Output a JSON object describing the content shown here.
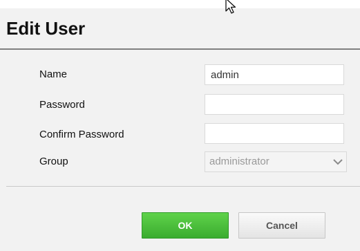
{
  "dialog": {
    "title": "Edit User"
  },
  "form": {
    "name_label": "Name",
    "name_value": "admin",
    "password_label": "Password",
    "password_value": "",
    "confirm_label": "Confirm Password",
    "confirm_value": "",
    "group_label": "Group",
    "group_value": "administrator"
  },
  "buttons": {
    "ok_label": "OK",
    "cancel_label": "Cancel"
  },
  "colors": {
    "ok_button": "#3fb634",
    "header_rule": "#7f7f7f",
    "dialog_bg": "#f2f2f2"
  },
  "icons": {
    "cursor": "mouse-pointer-icon",
    "group_dropdown": "chevron-down-icon"
  }
}
